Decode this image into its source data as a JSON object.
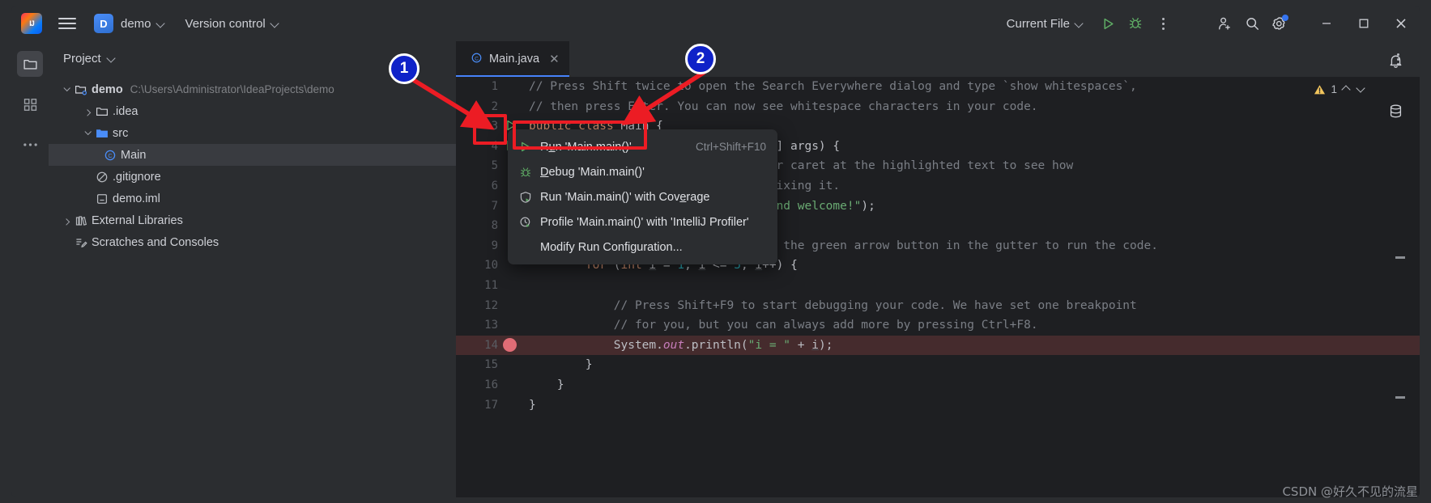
{
  "titlebar": {
    "logo": "intellij-logo",
    "menu_icon": "hamburger-menu-icon",
    "project_initial": "D",
    "project_name": "demo",
    "version_control": "Version control",
    "run_config": "Current File",
    "run_icon": "run-icon",
    "debug_icon": "debug-icon",
    "more_icon": "more-vertical-icon",
    "add_user_icon": "add-user-icon",
    "search_icon": "search-icon",
    "settings_icon": "gear-icon",
    "minimize": "─",
    "maximize": "☐",
    "close": "✕"
  },
  "activitybar": {
    "items": [
      {
        "name": "project-tool-window",
        "icon": "folder-icon"
      },
      {
        "name": "structure-tool-window",
        "icon": "structure-icon"
      },
      {
        "name": "more-tool-windows",
        "icon": "ellipsis-icon"
      }
    ]
  },
  "project_panel": {
    "title": "Project",
    "tree": [
      {
        "label": "demo",
        "path": "C:\\Users\\Administrator\\IdeaProjects\\demo",
        "icon": "project-folder-icon",
        "indent": 0,
        "twisty": "open",
        "bold": true,
        "selected": false
      },
      {
        "label": ".idea",
        "path": "",
        "icon": "folder-icon",
        "indent": 1,
        "twisty": "closed",
        "bold": false,
        "selected": false
      },
      {
        "label": "src",
        "path": "",
        "icon": "source-folder-icon",
        "indent": 1,
        "twisty": "open",
        "bold": false,
        "selected": false
      },
      {
        "label": "Main",
        "path": "",
        "icon": "java-class-icon",
        "indent": 2,
        "twisty": "none",
        "bold": false,
        "selected": true
      },
      {
        "label": ".gitignore",
        "path": "",
        "icon": "gitignore-icon",
        "indent": 1,
        "twisty": "none",
        "bold": false,
        "selected": false
      },
      {
        "label": "demo.iml",
        "path": "",
        "icon": "iml-file-icon",
        "indent": 1,
        "twisty": "none",
        "bold": false,
        "selected": false
      },
      {
        "label": "External Libraries",
        "path": "",
        "icon": "libraries-icon",
        "indent": 0,
        "twisty": "closed",
        "bold": false,
        "selected": false
      },
      {
        "label": "Scratches and Consoles",
        "path": "",
        "icon": "scratches-icon",
        "indent": 0,
        "twisty": "none",
        "bold": false,
        "selected": false
      }
    ]
  },
  "editor": {
    "tab_label": "Main.java",
    "tab_icon": "java-class-icon",
    "tab_close": "✕",
    "options_icon": "more-vertical-icon",
    "inspection_count": "1",
    "inspection_icon": "warning-triangle-icon",
    "lines": [
      {
        "no": "1",
        "html": "<span class='cmt'>// Press Shift twice to open the Search Everywhere dialog and type `show whitespaces`,</span>"
      },
      {
        "no": "2",
        "html": "<span class='cmt'>// then press Enter. You can now see whitespace characters in your code.</span>"
      },
      {
        "no": "3",
        "html": "<span class='kw'>public class </span><span class='white'>Main {</span>",
        "gutter": "run-gutter-icon"
      },
      {
        "no": "4",
        "html": "    <span class='kw'>public static void </span><span class='white'>main(String[] args) {</span>",
        "gutter": "run-gutter-icon"
      },
      {
        "no": "5",
        "html": "        <span class='cmt'>// Press Alt+Enter with your caret at the highlighted text to see how</span>"
      },
      {
        "no": "6",
        "html": "        <span class='cmt'>// IntelliJ IDEA suggests fixing it.</span>"
      },
      {
        "no": "7",
        "html": "        <span class='white'>System.</span><span class='fld'>out</span><span class='white'>.println(</span><span class='str'>\"Hello and welcome!\"</span><span class='white'>);</span>"
      },
      {
        "no": "8",
        "html": ""
      },
      {
        "no": "9",
        "html": "        <span class='cmt'>// Press Shift+F10 or click the green arrow button in the gutter to run the code.</span>"
      },
      {
        "no": "10",
        "html": "        <span class='kw'>for </span><span class='white'>(</span><span class='kw'>int </span><span class='var'>i</span><span class='white'> = </span><span class='num'>1</span><span class='white'>; </span><span class='var'>i</span><span class='white'> &lt;= </span><span class='num'>5</span><span class='white'>; </span><span class='var'>i</span><span class='white'>++) {</span>"
      },
      {
        "no": "11",
        "html": ""
      },
      {
        "no": "12",
        "html": "            <span class='cmt'>// Press Shift+F9 to start debugging your code. We have set one breakpoint</span>"
      },
      {
        "no": "13",
        "html": "            <span class='cmt'>// for you, but you can always add more by pressing Ctrl+F8.</span>"
      },
      {
        "no": "14",
        "html": "            <span class='white'>System.</span><span class='fld'>out</span><span class='white'>.println(</span><span class='str'>\"i = \"</span><span class='white'> + </span><span class='var'>i</span><span class='white'>);</span>",
        "breakpoint": true,
        "highlight": true
      },
      {
        "no": "15",
        "html": "        <span class='white'>}</span>"
      },
      {
        "no": "16",
        "html": "    <span class='white'>}</span>"
      },
      {
        "no": "17",
        "html": "<span class='white'>}</span>"
      }
    ]
  },
  "context_menu": {
    "items": [
      {
        "label": "Run 'Main.main()'",
        "shortcut": "Ctrl+Shift+F10",
        "icon": "run-icon",
        "mnemonic_index": 1,
        "highlighted": true
      },
      {
        "label": "Debug 'Main.main()'",
        "shortcut": "",
        "icon": "debug-icon",
        "mnemonic_index": 0,
        "highlighted": false
      },
      {
        "label": "Run 'Main.main()' with Coverage",
        "shortcut": "",
        "icon": "coverage-icon",
        "mnemonic_index": 26,
        "highlighted": false
      },
      {
        "label": "Profile 'Main.main()' with 'IntelliJ Profiler'",
        "shortcut": "",
        "icon": "profiler-icon",
        "mnemonic_index": -1,
        "highlighted": false
      },
      {
        "label": "Modify Run Configuration...",
        "shortcut": "",
        "icon": "none",
        "mnemonic_index": -1,
        "highlighted": false
      }
    ]
  },
  "right_sidebar": {
    "items": [
      {
        "name": "notifications",
        "icon": "bell-icon"
      },
      {
        "name": "database",
        "icon": "database-icon"
      }
    ]
  },
  "annotations": {
    "markers": [
      {
        "label": "1"
      },
      {
        "label": "2"
      }
    ],
    "accent_color": "#ec1c24",
    "marker_color": "#0f22c8"
  },
  "watermark": "CSDN @好久不见的流星"
}
